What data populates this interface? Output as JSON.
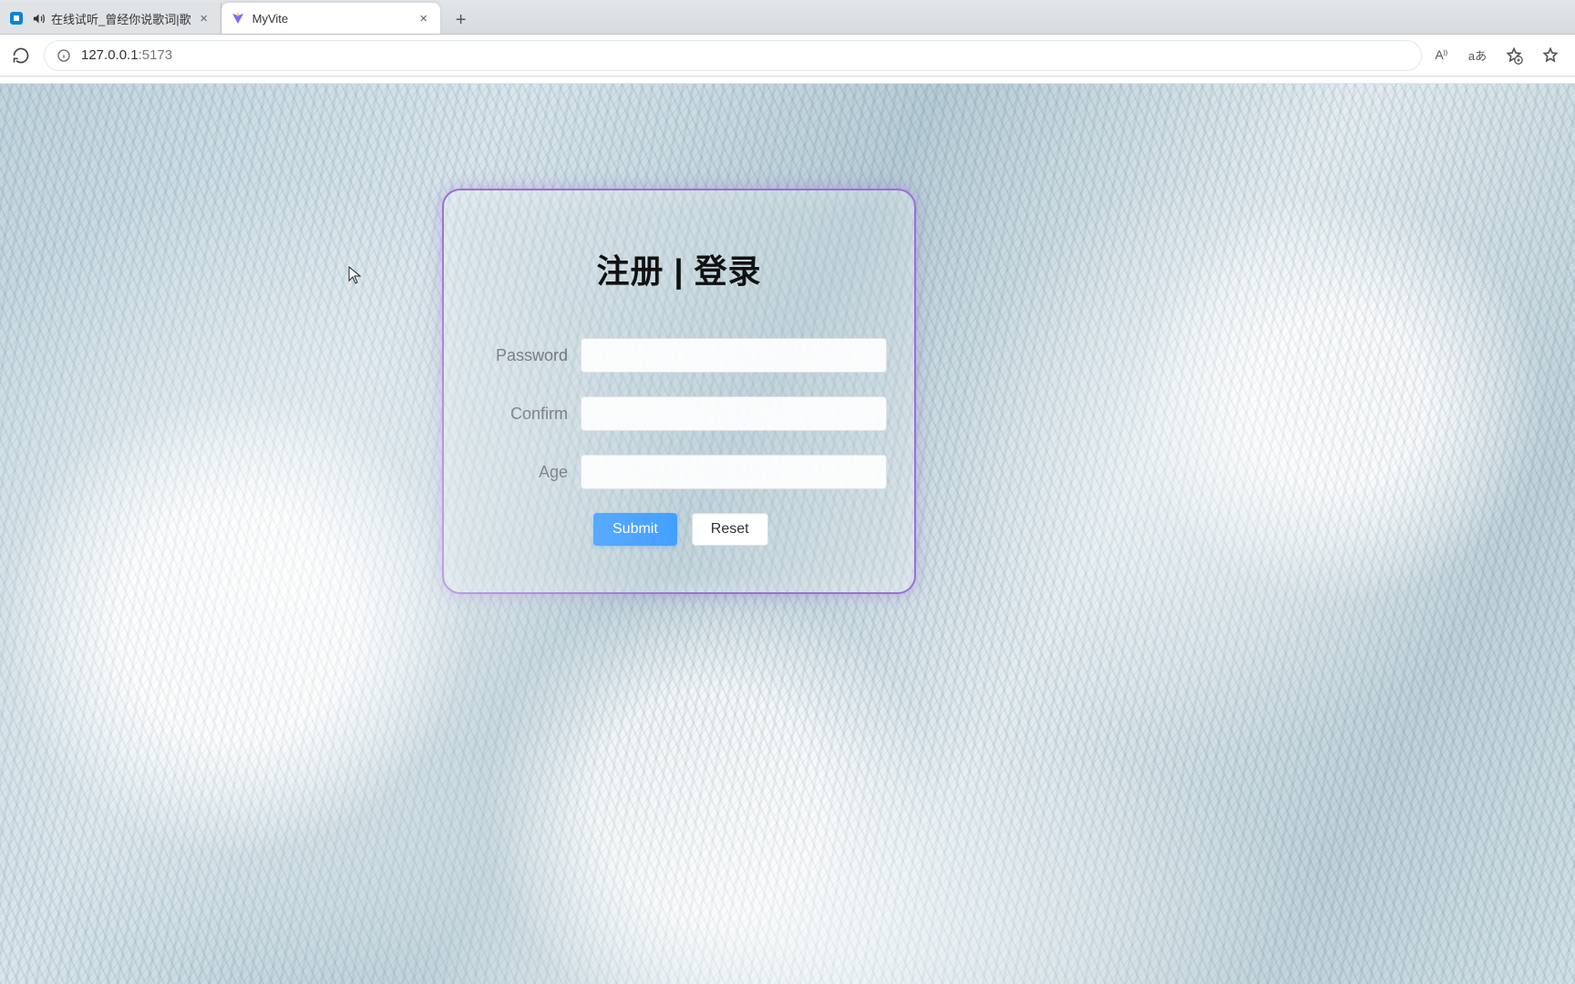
{
  "browser": {
    "tabs": [
      {
        "title": "在线试听_曾经你说歌词|歌",
        "active": false,
        "has_sound": true
      },
      {
        "title": "MyVite",
        "active": true,
        "has_sound": false
      }
    ],
    "url_host": "127.0.0.1",
    "url_port": ":5173",
    "toolbar_icons": {
      "read_aloud": "A⁾⁾",
      "translate": "aあ"
    }
  },
  "form": {
    "title": "注册 | 登录",
    "fields": {
      "password_label": "Password",
      "password_value": "",
      "confirm_label": "Confirm",
      "confirm_value": "",
      "age_label": "Age",
      "age_value": ""
    },
    "buttons": {
      "submit": "Submit",
      "reset": "Reset"
    },
    "colors": {
      "border": "#9b6fd6",
      "primary": "#409eff"
    }
  }
}
